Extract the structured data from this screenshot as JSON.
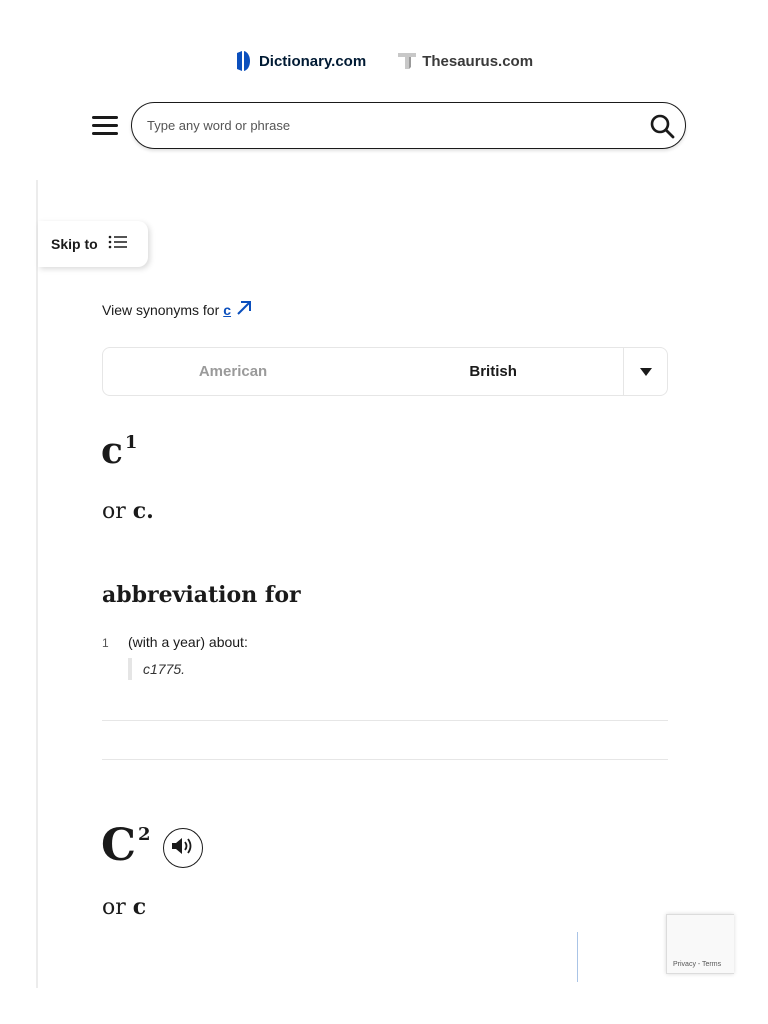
{
  "header": {
    "dictionary_brand": "Dictionary.com",
    "thesaurus_brand": "Thesaurus.com"
  },
  "search": {
    "placeholder": "Type any word or phrase",
    "value": ""
  },
  "skip_to": {
    "label": "Skip to"
  },
  "synonyms": {
    "prefix": "View synonyms for",
    "word": "c"
  },
  "tabs": {
    "items": [
      {
        "label": "American",
        "active": false
      },
      {
        "label": "British",
        "active": true
      }
    ]
  },
  "entry1": {
    "headword": "c",
    "homograph": "1",
    "or_prefix": "or",
    "variant": "c.",
    "part_of_speech": "abbreviation for",
    "definitions": [
      {
        "number": "1",
        "text": "(with a year) about:",
        "example": "c1775."
      }
    ]
  },
  "entry2": {
    "headword": "C",
    "homograph": "2",
    "or_prefix": "or",
    "variant": "c"
  },
  "recaptcha": {
    "links": "Privacy - Terms"
  },
  "colors": {
    "brand_blue": "#0b4fbd",
    "text": "#1a1a1a",
    "muted_tab": "#9a9a9a",
    "divider": "#e6e6e6"
  },
  "icons": [
    "dictionary-logo-icon",
    "thesaurus-logo-icon",
    "menu-icon",
    "search-icon",
    "list-icon",
    "arrow-up-right-icon",
    "caret-down-icon",
    "speaker-icon"
  ]
}
